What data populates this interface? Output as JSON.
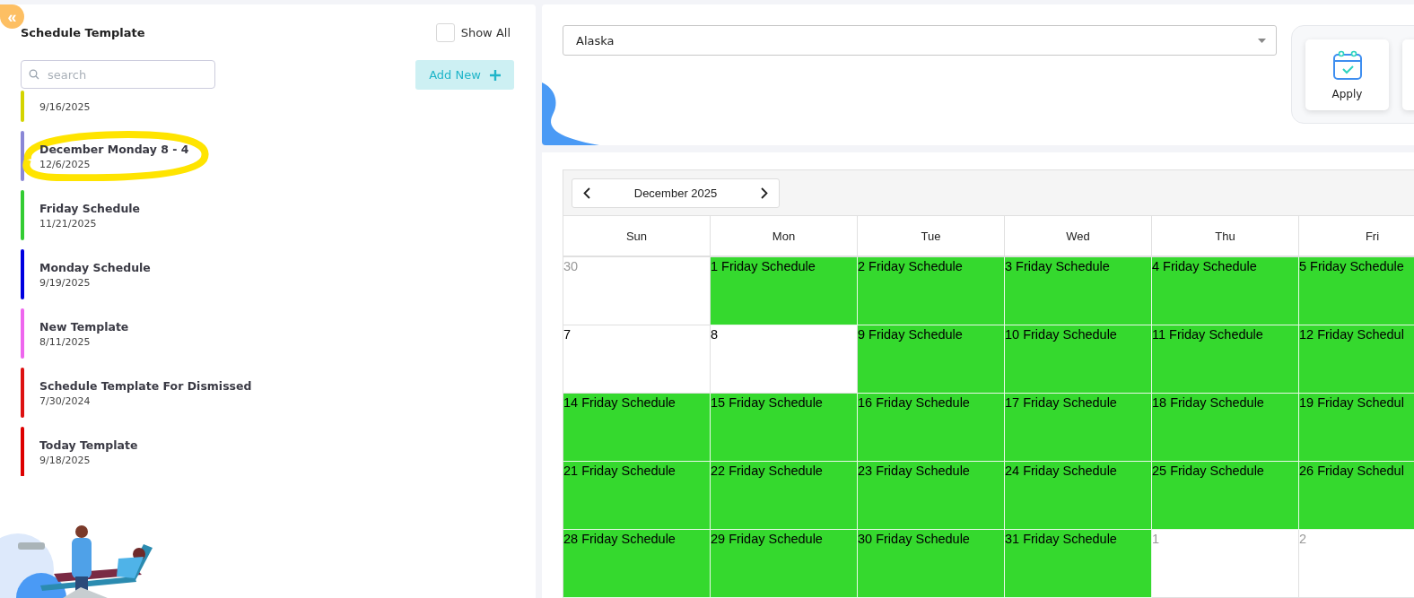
{
  "sidebar": {
    "collapse_button": "«",
    "title": "Schedule Template",
    "show_all": {
      "label": "Show All",
      "checked": false
    },
    "search": {
      "placeholder": "search"
    },
    "add_button": {
      "label": "Add New"
    },
    "items": [
      {
        "date": "9/16/2025",
        "color": "#d4d400"
      },
      {
        "title": "December Monday 8 - 4",
        "date": "12/6/2025",
        "color": "#8a87d6"
      },
      {
        "title": "Friday Schedule",
        "date": "11/21/2025",
        "color": "#33cc33"
      },
      {
        "title": "Monday Schedule",
        "date": "9/19/2025",
        "color": "#0000e0"
      },
      {
        "title": "New Template",
        "date": "8/11/2025",
        "color": "#ee66ee"
      },
      {
        "title": "Schedule Template For Dismissed",
        "date": "7/30/2024",
        "color": "#dd1111"
      },
      {
        "title": "Today Template",
        "date": "9/18/2025",
        "color": "#dd0000"
      }
    ]
  },
  "timezone_select": {
    "value": "Alaska"
  },
  "actions": [
    {
      "label": "Apply"
    }
  ],
  "calendar": {
    "month": "December 2025",
    "weekdays": [
      "Sun",
      "Mon",
      "Tue",
      "Wed",
      "Thu",
      "Fri"
    ],
    "weeks": [
      [
        {
          "text": "30",
          "other_month": true,
          "scheduled": false
        },
        {
          "text": "1 Friday Schedule",
          "other_month": false,
          "scheduled": true
        },
        {
          "text": "2 Friday Schedule",
          "other_month": false,
          "scheduled": true
        },
        {
          "text": "3 Friday Schedule",
          "other_month": false,
          "scheduled": true
        },
        {
          "text": "4 Friday Schedule",
          "other_month": false,
          "scheduled": true
        },
        {
          "text": "5 Friday Schedule",
          "other_month": false,
          "scheduled": true
        }
      ],
      [
        {
          "text": "7",
          "other_month": false,
          "scheduled": false
        },
        {
          "text": "8",
          "other_month": false,
          "scheduled": false
        },
        {
          "text": "9 Friday Schedule",
          "other_month": false,
          "scheduled": true
        },
        {
          "text": "10 Friday Schedule",
          "other_month": false,
          "scheduled": true
        },
        {
          "text": "11 Friday Schedule",
          "other_month": false,
          "scheduled": true
        },
        {
          "text": "12 Friday Schedul",
          "other_month": false,
          "scheduled": true
        }
      ],
      [
        {
          "text": "14 Friday Schedule",
          "other_month": false,
          "scheduled": true
        },
        {
          "text": "15 Friday Schedule",
          "other_month": false,
          "scheduled": true
        },
        {
          "text": "16 Friday Schedule",
          "other_month": false,
          "scheduled": true
        },
        {
          "text": "17 Friday Schedule",
          "other_month": false,
          "scheduled": true
        },
        {
          "text": "18 Friday Schedule",
          "other_month": false,
          "scheduled": true
        },
        {
          "text": "19 Friday Schedul",
          "other_month": false,
          "scheduled": true
        }
      ],
      [
        {
          "text": "21 Friday Schedule",
          "other_month": false,
          "scheduled": true
        },
        {
          "text": "22 Friday Schedule",
          "other_month": false,
          "scheduled": true
        },
        {
          "text": "23 Friday Schedule",
          "other_month": false,
          "scheduled": true
        },
        {
          "text": "24 Friday Schedule",
          "other_month": false,
          "scheduled": true
        },
        {
          "text": "25 Friday Schedule",
          "other_month": false,
          "scheduled": true
        },
        {
          "text": "26 Friday Schedul",
          "other_month": false,
          "scheduled": true
        }
      ],
      [
        {
          "text": "28 Friday Schedule",
          "other_month": false,
          "scheduled": true
        },
        {
          "text": "29 Friday Schedule",
          "other_month": false,
          "scheduled": true
        },
        {
          "text": "30 Friday Schedule",
          "other_month": false,
          "scheduled": true
        },
        {
          "text": "31 Friday Schedule",
          "other_month": false,
          "scheduled": true
        },
        {
          "text": "1",
          "other_month": true,
          "scheduled": false
        },
        {
          "text": "2",
          "other_month": true,
          "scheduled": false
        }
      ]
    ]
  }
}
